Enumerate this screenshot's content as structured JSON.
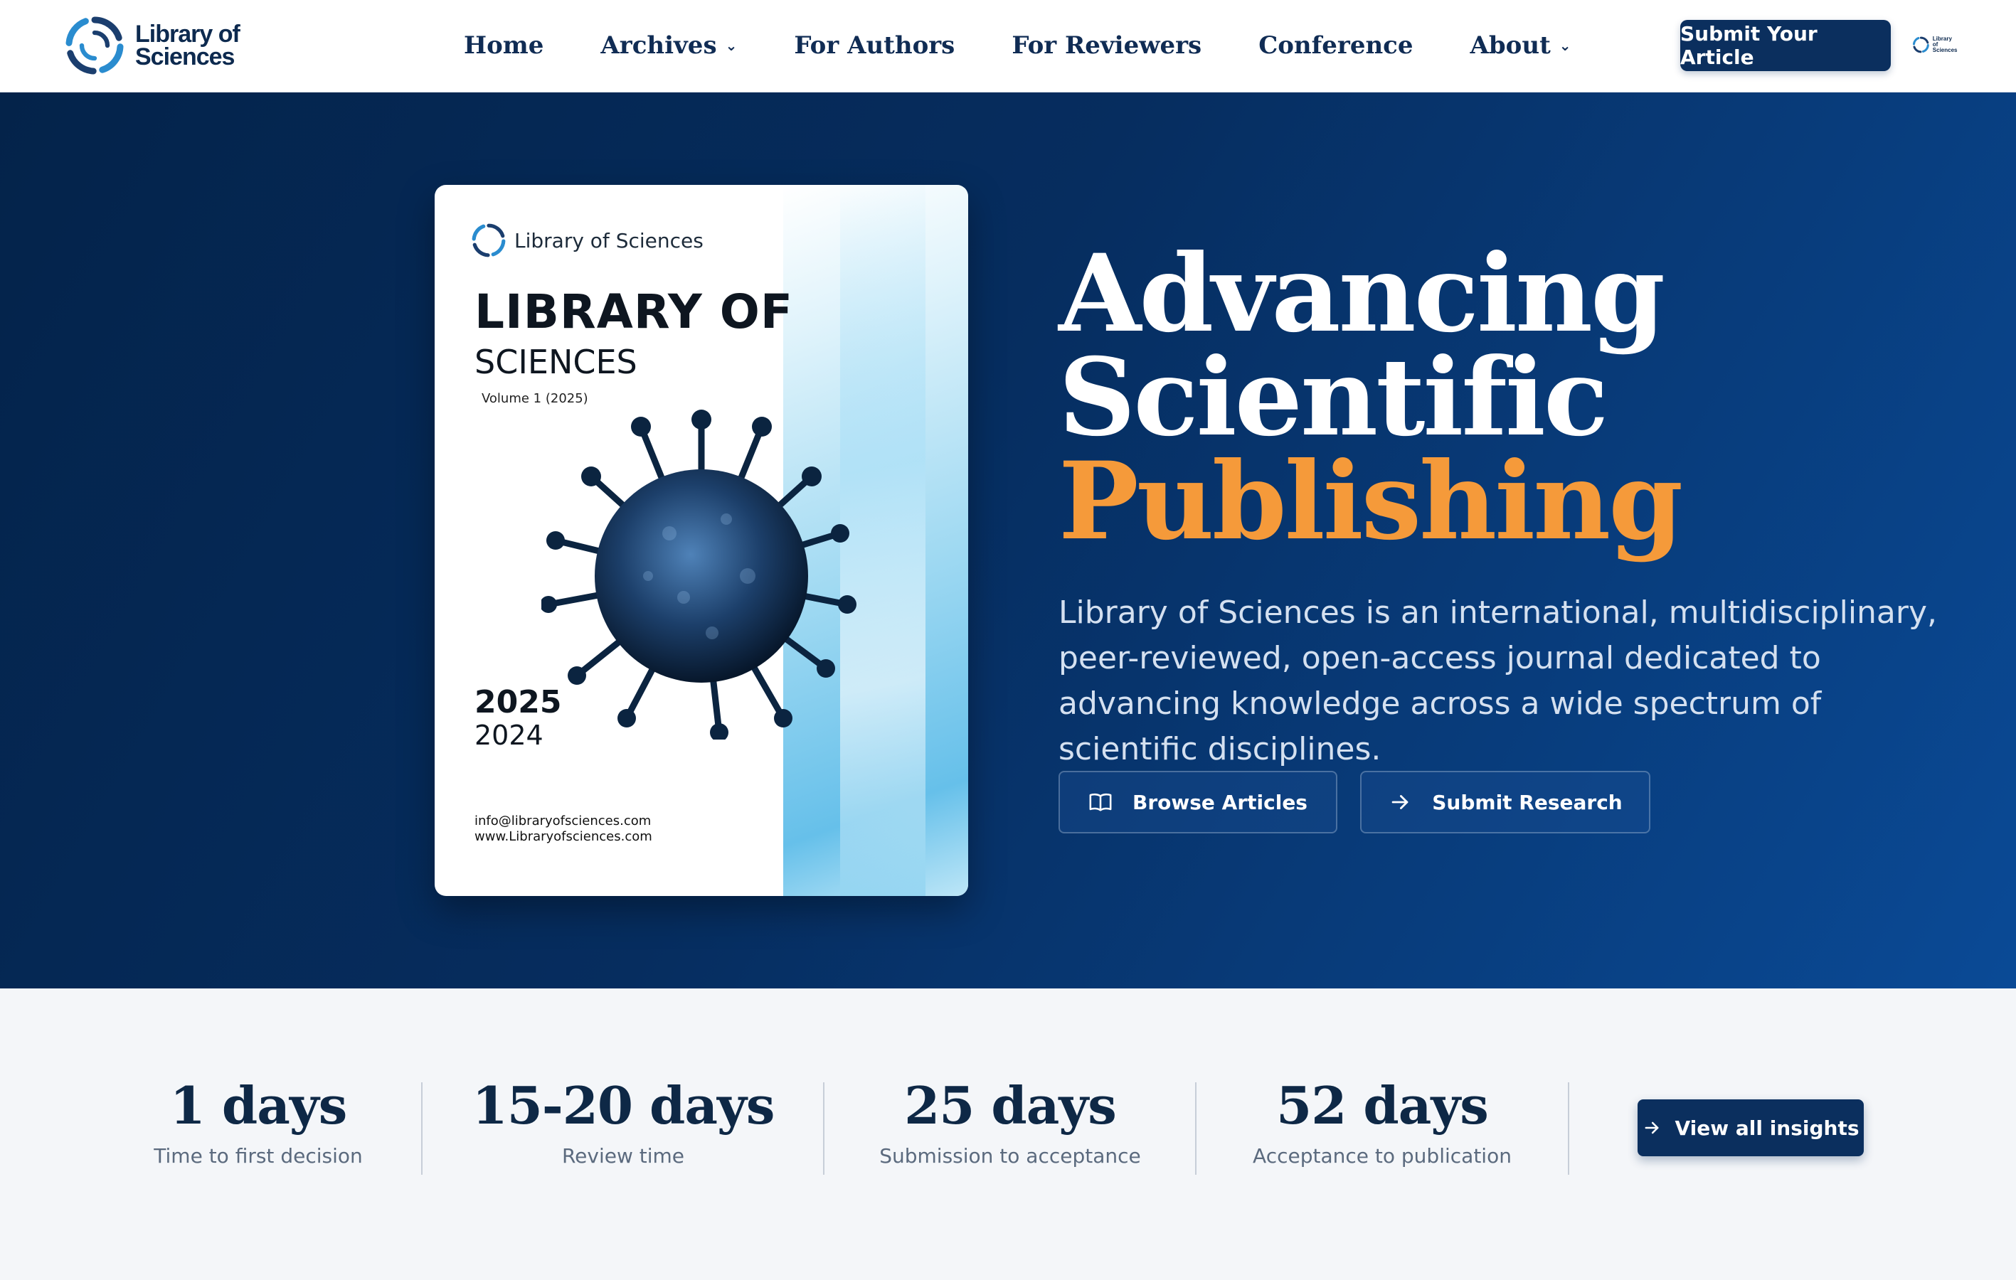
{
  "header": {
    "logo_line1": "Library of",
    "logo_line2": "Sciences",
    "nav": [
      {
        "label": "Home",
        "has_dropdown": false
      },
      {
        "label": "Archives",
        "has_dropdown": true
      },
      {
        "label": "For Authors",
        "has_dropdown": false
      },
      {
        "label": "For Reviewers",
        "has_dropdown": false
      },
      {
        "label": "Conference",
        "has_dropdown": false
      },
      {
        "label": "About",
        "has_dropdown": true
      }
    ],
    "dropdown_icon": "chevron-down-icon",
    "submit_label": "Submit Your Article",
    "mini_logo_line1": "Library of",
    "mini_logo_line2": "Sciences"
  },
  "cover": {
    "brand": "Library of Sciences",
    "title_line1": "LIBRARY OF",
    "title_line2": "SCIENCES",
    "volume": "Volume 1  (2025)",
    "year1": "2025",
    "year2": "2024",
    "email": "info@libraryofsciences.com",
    "website": "www.Libraryofsciences.com"
  },
  "hero": {
    "title_line1": "Advancing",
    "title_line2": "Scientific",
    "title_line3": "Publishing",
    "description": "Library of Sciences is an international, multidisciplinary, peer-reviewed, open-access journal dedicated to advancing knowledge across a wide spectrum of scientific disciplines.",
    "browse_label": "Browse Articles",
    "browse_icon": "book-open-icon",
    "research_label": "Submit Research",
    "research_icon": "arrow-right-icon"
  },
  "stats": {
    "items": [
      {
        "value": "1 days",
        "label": "Time to first decision"
      },
      {
        "value": "15-20 days",
        "label": "Review time"
      },
      {
        "value": "25 days",
        "label": "Submission to acceptance"
      },
      {
        "value": "52 days",
        "label": "Acceptance to publication"
      }
    ],
    "insights_label": "View all insights",
    "insights_icon": "arrow-right-icon"
  },
  "colors": {
    "brand_navy": "#0b2f5e",
    "accent_orange": "#f59a3a",
    "hero_bg": "#062d5f"
  }
}
